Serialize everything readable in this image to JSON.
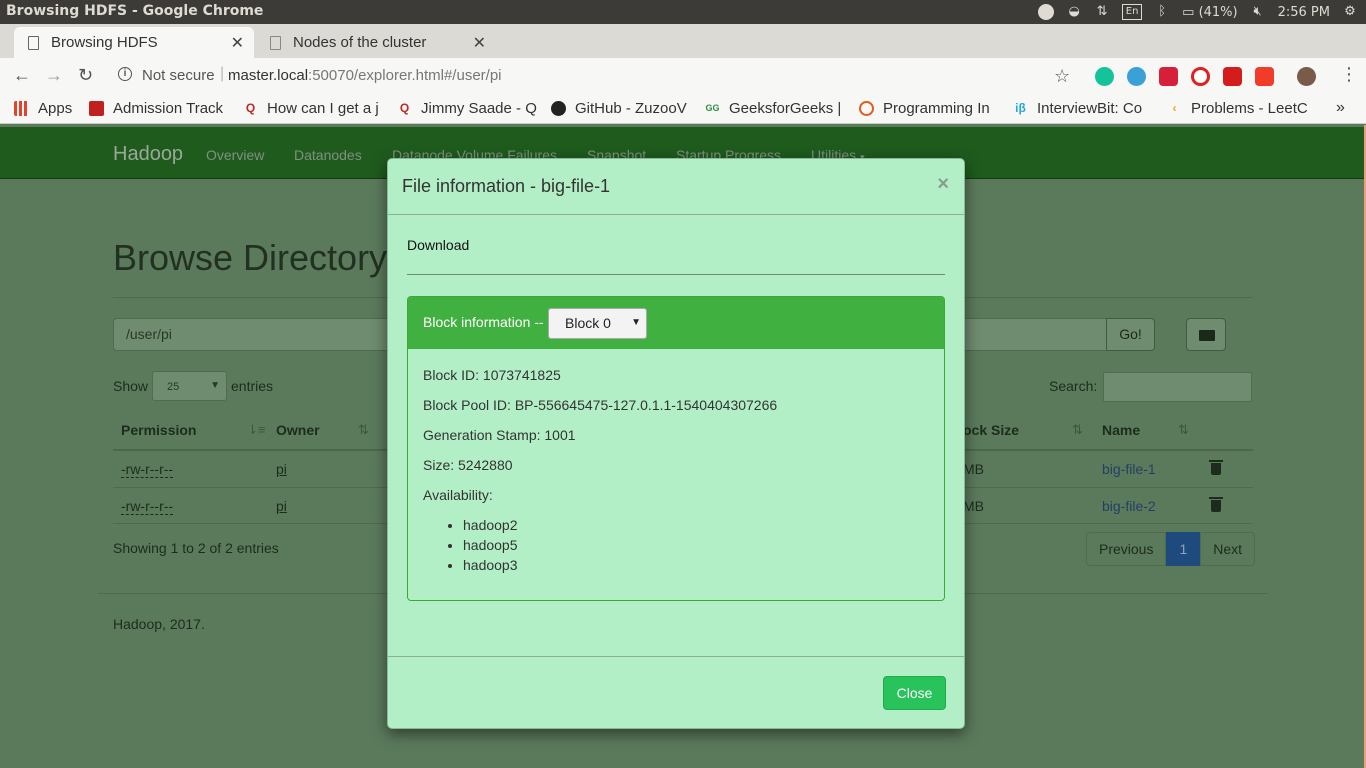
{
  "os": {
    "window_title": "Browsing HDFS - Google Chrome",
    "keyboard": "En",
    "battery": "(41%)",
    "clock": "2:56 PM"
  },
  "browser": {
    "tabs": [
      {
        "label": "Browsing HDFS",
        "active": true
      },
      {
        "label": "Nodes of the cluster",
        "active": false
      }
    ],
    "security_label": "Not secure",
    "url_host": "master.local",
    "url_rest": ":50070/explorer.html#/user/pi",
    "bookmarks": [
      {
        "label": "Apps",
        "icon": "apps-grid-icon",
        "color": "#e0452c"
      },
      {
        "label": "Admission Track",
        "icon": "admission-icon",
        "color": "#c0201e"
      },
      {
        "label": "How can I get a j",
        "icon": "quora-icon",
        "color": "#b92b27"
      },
      {
        "label": "Jimmy Saade - Q",
        "icon": "quora-icon",
        "color": "#b92b27"
      },
      {
        "label": "GitHub - ZuzooV",
        "icon": "github-icon",
        "color": "#222222"
      },
      {
        "label": "GeeksforGeeks |",
        "icon": "geeksforgeeks-icon",
        "color": "#2f8d46"
      },
      {
        "label": "Programming In",
        "icon": "programming-icon",
        "color": "#e35a1f"
      },
      {
        "label": "InterviewBit: Co",
        "icon": "interviewbit-icon",
        "color": "#2aa8d8"
      },
      {
        "label": "Problems - LeetC",
        "icon": "leetcode-icon",
        "color": "#f0a030"
      }
    ]
  },
  "page": {
    "brand": "Hadoop",
    "nav": [
      "Overview",
      "Datanodes",
      "Datanode Volume Failures",
      "Snapshot",
      "Startup Progress",
      "Utilities"
    ],
    "heading": "Browse Directory",
    "path_value": "/user/pi",
    "go_label": "Go!",
    "show_label": "Show",
    "page_size": "25",
    "entries_label": "entries",
    "search_label": "Search:",
    "columns": {
      "permission": "Permission",
      "owner": "Owner",
      "block_size": "ock Size",
      "name": "Name"
    },
    "rows": [
      {
        "permission": "-rw-r--r--",
        "owner": "pi",
        "size_tail": "MB",
        "name": "big-file-1"
      },
      {
        "permission": "-rw-r--r--",
        "owner": "pi",
        "size_tail": "MB",
        "name": "big-file-2"
      }
    ],
    "showing": "Showing 1 to 2 of 2 entries",
    "pager": {
      "previous": "Previous",
      "current": "1",
      "next": "Next"
    },
    "footer": "Hadoop, 2017."
  },
  "modal": {
    "title": "File information - big-file-1",
    "close_x": "×",
    "download": "Download",
    "block_label": "Block information --",
    "block_selected": "Block 0",
    "block_id": "Block ID: 1073741825",
    "block_pool_id": "Block Pool ID: BP-556645475-127.0.1.1-1540404307266",
    "generation_stamp": "Generation Stamp: 1001",
    "size": "Size: 5242880",
    "availability_label": "Availability:",
    "availability": [
      "hadoop2",
      "hadoop5",
      "hadoop3"
    ],
    "close_button": "Close"
  }
}
